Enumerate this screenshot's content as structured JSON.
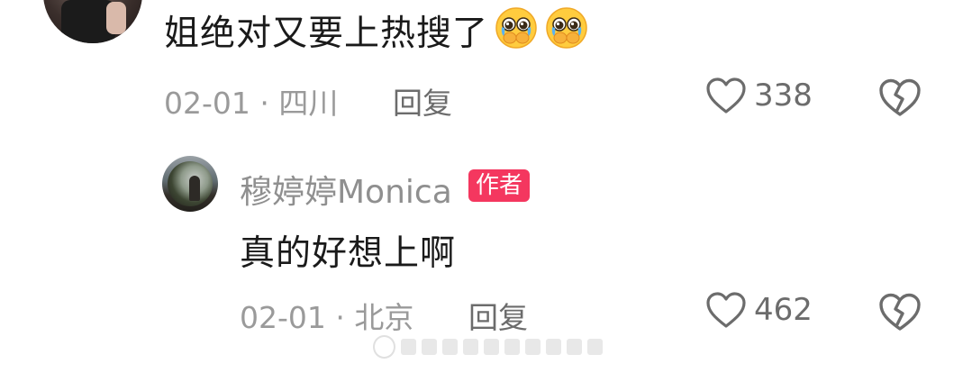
{
  "comments": [
    {
      "text": "姐绝对又要上热搜了",
      "emojis": [
        "pleading-face",
        "pleading-face"
      ],
      "date": "02-01",
      "separator": "·",
      "location": "四川",
      "reply_label": "回复",
      "likes": "338"
    },
    {
      "username": "穆婷婷Monica",
      "badge": "作者",
      "text": "真的好想上啊",
      "date": "02-01",
      "separator": "·",
      "location": "北京",
      "reply_label": "回复",
      "likes": "462"
    }
  ],
  "icons": {
    "like": "heart-icon",
    "dislike": "broken-heart-icon"
  },
  "colors": {
    "badge_bg": "#f4375f",
    "meta_text": "#9a9a9a",
    "icon_gray": "#6c6c6c"
  }
}
